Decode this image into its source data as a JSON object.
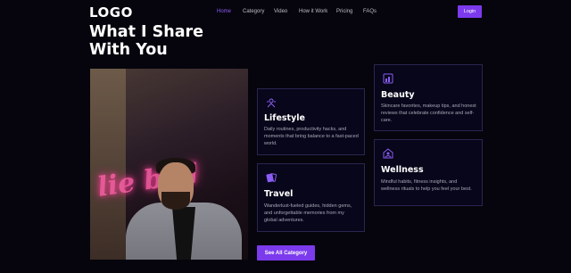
{
  "header": {
    "logo": "LOGO",
    "nav": [
      {
        "label": "Home",
        "active": true
      },
      {
        "label": "Category",
        "active": false
      },
      {
        "label": "Video",
        "active": false
      },
      {
        "label": "How it Work",
        "active": false
      },
      {
        "label": "Pricing",
        "active": false
      },
      {
        "label": "FAQs",
        "active": false
      }
    ],
    "login_label": "Login"
  },
  "main": {
    "heading": "What I Share With You",
    "photo_neon_text": "lie bad",
    "cards": [
      {
        "icon": "lifestyle-icon",
        "title": "Lifestyle",
        "description": "Daily routines, productivity hacks, and moments that bring balance to a fast-paced world."
      },
      {
        "icon": "travel-icon",
        "title": "Travel",
        "description": "Wanderlust-fueled guides, hidden gems, and unforgettable memories from my global adventures."
      },
      {
        "icon": "beauty-icon",
        "title": "Beauty",
        "description": "Skincare favorites, makeup tips, and honest reviews that celebrate confidence and self-care."
      },
      {
        "icon": "wellness-icon",
        "title": "Wellness",
        "description": "Mindful habits, fitness insights, and wellness rituals to help you feel your best."
      }
    ],
    "see_all_label": "See All Category"
  },
  "colors": {
    "background": "#06050d",
    "accent": "#7c3aed",
    "active_nav": "#8b5cf6",
    "card_border": "#2b2550"
  }
}
